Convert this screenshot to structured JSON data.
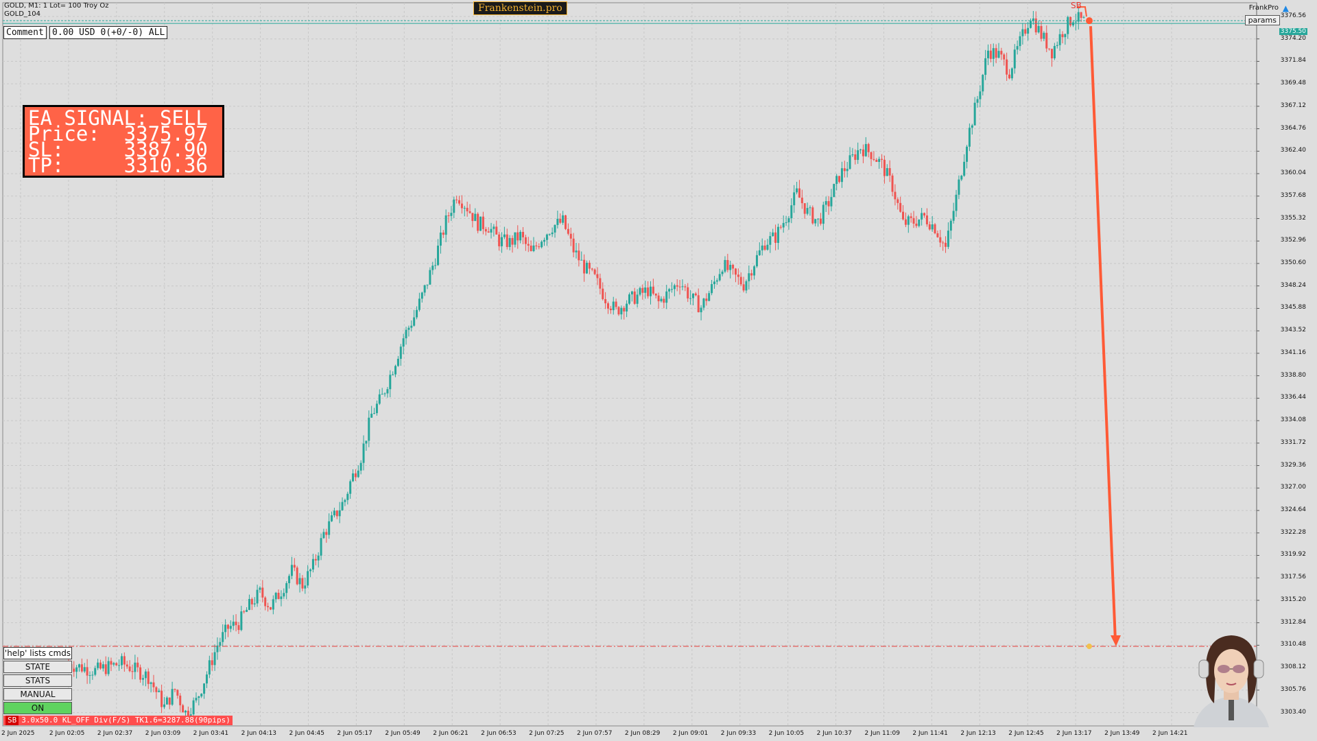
{
  "header": {
    "symbol_line": "GOLD, M1:  1 Lot= 100 Troy Oz",
    "account_line": "GOLD_104",
    "brand": "Frankenstein.pro",
    "frankpro": "FrankPro",
    "params": "params",
    "sb_marker": "SB"
  },
  "comment": {
    "label": "Comment",
    "value": "0.00 USD 0(+0/-0) ALL"
  },
  "signal": {
    "line1": "EA SIGNAL: SELL",
    "line2": "Price:  3375.97",
    "line3": "SL:     3387.90",
    "line4": "TP:     3310.36"
  },
  "commands": {
    "help": "'help' lists cmds",
    "state": "STATE",
    "stats": "STATS",
    "manual": "MANUAL",
    "on": "ON"
  },
  "status_bar": {
    "sb": "SB",
    "text": "3.0x50.0 KL_OFF Div(F/S) TK1.6=3287.88(90pips)"
  },
  "price_axis": {
    "labels": [
      "3376.56",
      "3374.20",
      "3371.84",
      "3369.48",
      "3367.12",
      "3364.76",
      "3362.40",
      "3360.04",
      "3357.68",
      "3355.32",
      "3352.96",
      "3350.60",
      "3348.24",
      "3345.88",
      "3343.52",
      "3341.16",
      "3338.80",
      "3336.44",
      "3334.08",
      "3331.72",
      "3329.36",
      "3327.00",
      "3324.64",
      "3322.28",
      "3319.92",
      "3317.56",
      "3315.20",
      "3312.84",
      "3310.48",
      "3308.12",
      "3305.76",
      "3303.40"
    ],
    "current_price": "3375.50"
  },
  "time_axis": {
    "labels": [
      "2 Jun 2025",
      "2 Jun 02:05",
      "2 Jun 02:37",
      "2 Jun 03:09",
      "2 Jun 03:41",
      "2 Jun 04:13",
      "2 Jun 04:45",
      "2 Jun 05:17",
      "2 Jun 05:49",
      "2 Jun 06:21",
      "2 Jun 06:53",
      "2 Jun 07:25",
      "2 Jun 07:57",
      "2 Jun 08:29",
      "2 Jun 09:01",
      "2 Jun 09:33",
      "2 Jun 10:05",
      "2 Jun 10:37",
      "2 Jun 11:09",
      "2 Jun 11:41",
      "2 Jun 12:13",
      "2 Jun 12:45",
      "2 Jun 13:17",
      "2 Jun 13:49",
      "2 Jun 14:21"
    ]
  },
  "colors": {
    "bull": "#26a69a",
    "bear": "#ef5350",
    "arrow": "#ff5a36",
    "tp_line": "#e53935",
    "price_line": "#26a69a",
    "background": "#dedede"
  },
  "chart_data": {
    "type": "candlestick",
    "ylim": [
      3302.0,
      3378.0
    ],
    "price_path": [
      [
        0,
        3308.5
      ],
      [
        10,
        3307.8
      ],
      [
        20,
        3308.6
      ],
      [
        30,
        3307.2
      ],
      [
        36,
        3304.0
      ],
      [
        40,
        3305.8
      ],
      [
        44,
        3303.4
      ],
      [
        48,
        3304.6
      ],
      [
        52,
        3307.5
      ],
      [
        56,
        3310.5
      ],
      [
        60,
        3312.3
      ],
      [
        64,
        3312.8
      ],
      [
        68,
        3314.6
      ],
      [
        72,
        3316.0
      ],
      [
        76,
        3314.5
      ],
      [
        80,
        3316.2
      ],
      [
        84,
        3318.3
      ],
      [
        88,
        3316.8
      ],
      [
        92,
        3318.8
      ],
      [
        96,
        3322.2
      ],
      [
        100,
        3324.0
      ],
      [
        104,
        3325.8
      ],
      [
        106,
        3327.6
      ],
      [
        110,
        3330.3
      ],
      [
        114,
        3334.7
      ],
      [
        118,
        3336.6
      ],
      [
        122,
        3339.6
      ],
      [
        126,
        3342.8
      ],
      [
        130,
        3345.0
      ],
      [
        134,
        3347.9
      ],
      [
        138,
        3351.2
      ],
      [
        142,
        3355.0
      ],
      [
        146,
        3357.9
      ],
      [
        150,
        3356.5
      ],
      [
        154,
        3354.8
      ],
      [
        158,
        3354.5
      ],
      [
        162,
        3353.0
      ],
      [
        166,
        3352.8
      ],
      [
        170,
        3353.5
      ],
      [
        174,
        3351.6
      ],
      [
        178,
        3353.3
      ],
      [
        182,
        3354.5
      ],
      [
        186,
        3355.0
      ],
      [
        190,
        3352.0
      ],
      [
        194,
        3350.2
      ],
      [
        198,
        3349.0
      ],
      [
        202,
        3347.0
      ],
      [
        206,
        3345.6
      ],
      [
        210,
        3346.6
      ],
      [
        214,
        3347.2
      ],
      [
        218,
        3347.8
      ],
      [
        222,
        3346.5
      ],
      [
        226,
        3347.6
      ],
      [
        230,
        3348.8
      ],
      [
        234,
        3347.0
      ],
      [
        238,
        3346.0
      ],
      [
        242,
        3348.0
      ],
      [
        246,
        3350.5
      ],
      [
        250,
        3349.4
      ],
      [
        254,
        3348.4
      ],
      [
        258,
        3350.7
      ],
      [
        262,
        3352.8
      ],
      [
        266,
        3353.4
      ],
      [
        270,
        3355.5
      ],
      [
        274,
        3358.0
      ],
      [
        278,
        3356.0
      ],
      [
        282,
        3355.0
      ],
      [
        286,
        3357.0
      ],
      [
        290,
        3359.8
      ],
      [
        294,
        3361.3
      ],
      [
        298,
        3362.8
      ],
      [
        302,
        3362.2
      ],
      [
        306,
        3361.0
      ],
      [
        310,
        3358.7
      ],
      [
        314,
        3354.8
      ],
      [
        318,
        3355.0
      ],
      [
        322,
        3355.5
      ],
      [
        326,
        3354.4
      ],
      [
        330,
        3352.2
      ],
      [
        334,
        3357.5
      ],
      [
        338,
        3363.5
      ],
      [
        342,
        3367.9
      ],
      [
        346,
        3373.0
      ],
      [
        350,
        3372.5
      ],
      [
        354,
        3370.8
      ],
      [
        358,
        3373.8
      ],
      [
        362,
        3376.7
      ],
      [
        366,
        3374.6
      ],
      [
        370,
        3372.9
      ],
      [
        374,
        3375.0
      ],
      [
        378,
        3376.5
      ],
      [
        382,
        3375.97
      ]
    ],
    "signal": {
      "type": "SELL",
      "entry": 3375.97,
      "stop_loss": 3387.9,
      "take_profit": 3310.36
    }
  }
}
